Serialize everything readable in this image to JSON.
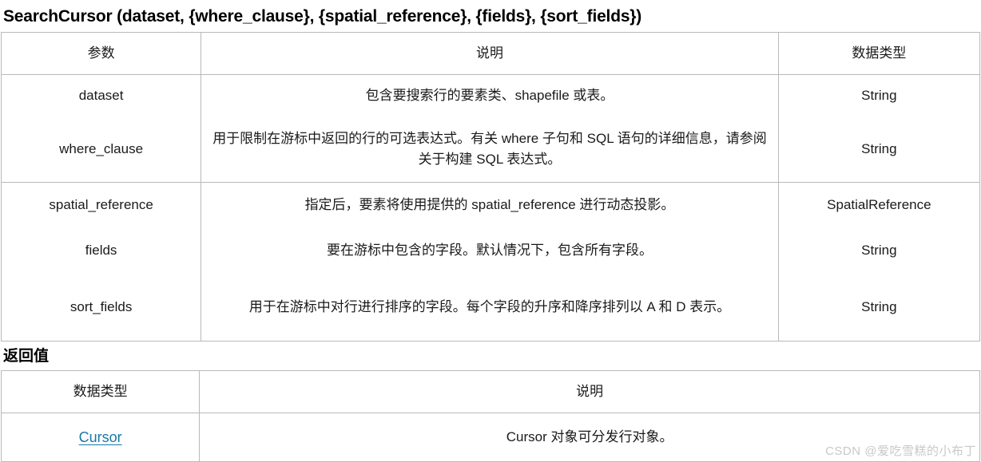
{
  "document": {
    "title": "SearchCursor (dataset, {where_clause}, {spatial_reference}, {fields}, {sort_fields})",
    "return_section_heading": "返回值",
    "watermark": "CSDN @爱吃雪糕的小布丁",
    "link_color": "#1878a8",
    "border_color": "#b9b9b9"
  },
  "parameters_table": {
    "headers": {
      "parameter": "参数",
      "description": "说明",
      "data_type": "数据类型"
    },
    "rows": [
      {
        "parameter": "dataset",
        "description": "包含要搜索行的要素类、shapefile 或表。",
        "data_type": "String"
      },
      {
        "parameter": "where_clause",
        "description": "用于限制在游标中返回的行的可选表达式。有关 where 子句和 SQL 语句的详细信息，请参阅 关于构建 SQL 表达式。",
        "data_type": "String"
      },
      {
        "parameter": "spatial_reference",
        "description": "指定后，要素将使用提供的 spatial_reference 进行动态投影。",
        "data_type": "SpatialReference"
      },
      {
        "parameter": "fields",
        "description": "要在游标中包含的字段。默认情况下，包含所有字段。",
        "data_type": "String"
      },
      {
        "parameter": "sort_fields",
        "description": "用于在游标中对行进行排序的字段。每个字段的升序和降序排列以 A 和 D 表示。",
        "data_type": "String"
      }
    ]
  },
  "return_table": {
    "headers": {
      "data_type": "数据类型",
      "description": "说明"
    },
    "rows": [
      {
        "data_type": "Cursor",
        "description": "Cursor 对象可分发行对象。"
      }
    ]
  }
}
